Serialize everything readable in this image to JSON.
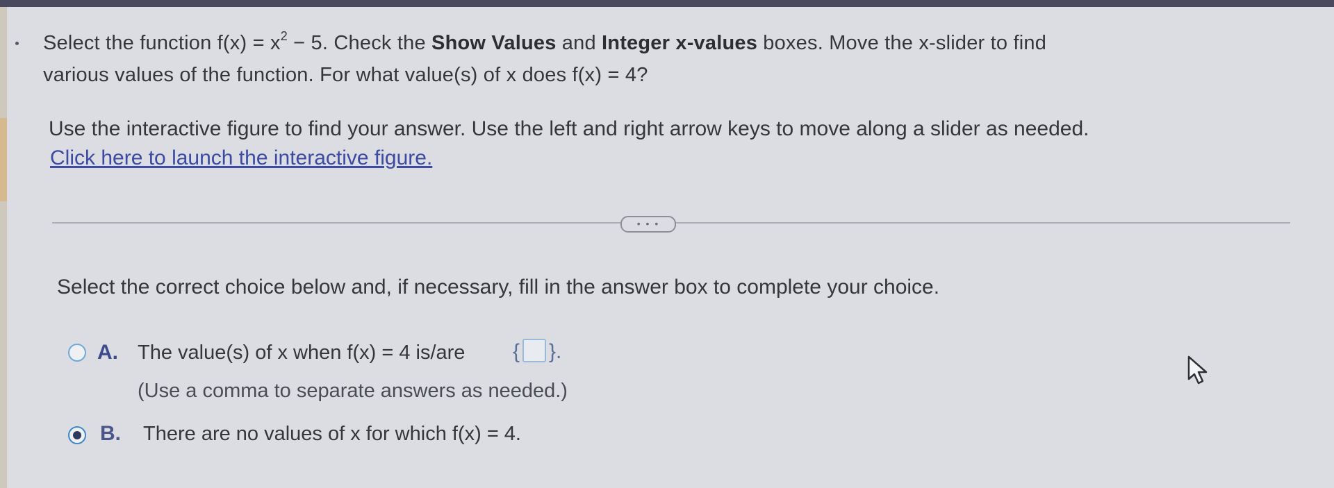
{
  "question": {
    "line1": {
      "part1": "Select the function f(x) = x",
      "exponent": "2",
      "part2": " − 5.  Check the ",
      "bold1": "Show Values",
      "part3": " and ",
      "bold2": "Integer x-values",
      "part4": " boxes.  Move the x-slider to find"
    },
    "line2": "various values of the function.  For what value(s) of x does f(x) = 4?"
  },
  "instruction": "Use the interactive figure to find your answer. Use the left and right arrow keys to move along a slider as needed.",
  "launch_link": "Click here to launch the interactive figure.",
  "more_button": "• • •",
  "prompt": "Select the correct choice below and, if necessary, fill in the answer box to complete your choice.",
  "choices": {
    "a": {
      "letter": "A.",
      "text": "The value(s) of x when f(x) = 4 is/are",
      "open_brace": "{",
      "close_brace": "}.",
      "hint": "(Use a comma to separate answers as needed.)",
      "selected": false
    },
    "b": {
      "letter": "B.",
      "text": "There are no values of x for which f(x) = 4.",
      "selected": true
    }
  },
  "colors": {
    "background": "#dcdde2",
    "link": "#3b4aa3",
    "accent_radio": "#3f88c5"
  }
}
